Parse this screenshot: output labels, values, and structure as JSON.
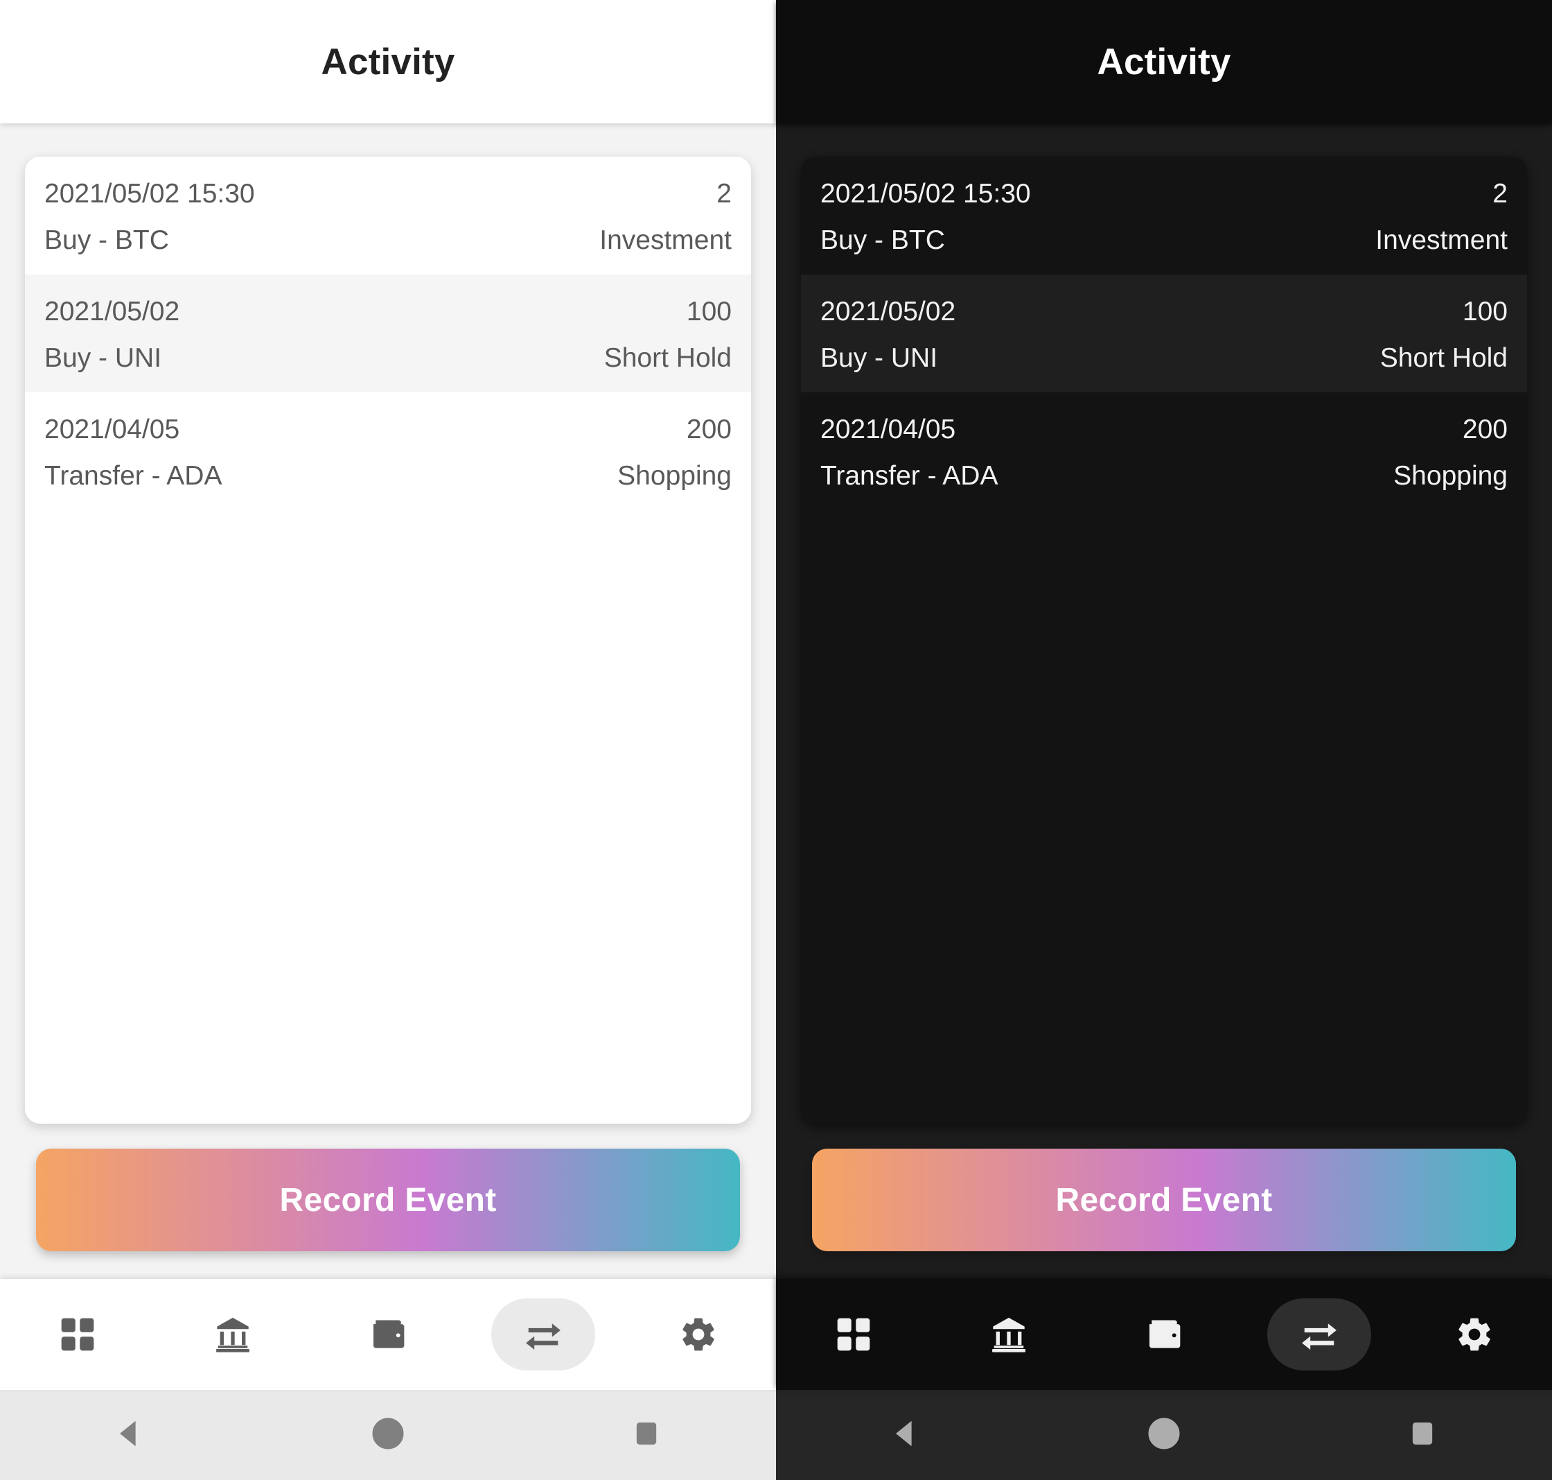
{
  "app": {
    "title": "Activity"
  },
  "activity": {
    "rows": [
      {
        "date": "2021/05/02 15:30",
        "amount": "2",
        "description": "Buy - BTC",
        "category": "Investment"
      },
      {
        "date": "2021/05/02",
        "amount": "100",
        "description": "Buy - UNI",
        "category": "Short Hold"
      },
      {
        "date": "2021/04/05",
        "amount": "200",
        "description": "Transfer - ADA",
        "category": "Shopping"
      }
    ]
  },
  "cta": {
    "label": "Record Event",
    "gradient_start": "#f5a463",
    "gradient_mid": "#c87ad0",
    "gradient_end": "#45b8c4"
  },
  "bottom_nav": {
    "items": [
      {
        "icon": "grid-icon",
        "name": "dashboard",
        "active": false
      },
      {
        "icon": "bank-icon",
        "name": "bank",
        "active": false
      },
      {
        "icon": "wallet-icon",
        "name": "wallet",
        "active": false
      },
      {
        "icon": "swap-icon",
        "name": "activity",
        "active": true
      },
      {
        "icon": "gear-icon",
        "name": "settings",
        "active": false
      }
    ]
  },
  "system_nav": {
    "items": [
      {
        "icon": "back-triangle-icon",
        "name": "back"
      },
      {
        "icon": "home-circle-icon",
        "name": "home"
      },
      {
        "icon": "recents-square-icon",
        "name": "recents"
      }
    ]
  },
  "themes": {
    "light": {
      "appbar_bg": "#ffffff",
      "body_bg": "#f3f3f3",
      "card_bg": "#ffffff",
      "row_alt_bg": "#f5f5f5",
      "text": "#595959",
      "title": "#222222",
      "nav_bg": "#ffffff",
      "nav_icon": "#5e5e5e",
      "nav_active_pill": "#eaeaea",
      "sysnav_bg": "#e9e9e9",
      "sysnav_icon": "#808080"
    },
    "dark": {
      "appbar_bg": "#0d0d0d",
      "body_bg": "#1c1c1c",
      "card_bg": "#131313",
      "row_alt_bg": "#1f1f1f",
      "text": "#f2f2f2",
      "title": "#ffffff",
      "nav_bg": "#0d0d0d",
      "nav_icon": "#f0f0f0",
      "nav_active_pill": "#2e2e2e",
      "sysnav_bg": "#262626",
      "sysnav_icon": "#adadad"
    }
  }
}
